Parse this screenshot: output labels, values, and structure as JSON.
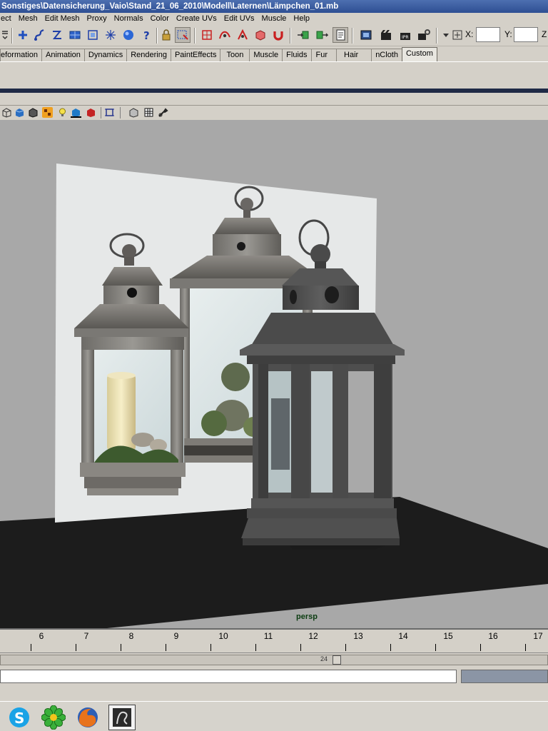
{
  "window": {
    "title": "Sonstiges\\Datensicherung_Vaio\\Stand_21_06_2010\\Modell\\Laternen\\Lämpchen_01.mb"
  },
  "menu": {
    "items": [
      "ect",
      "Mesh",
      "Edit Mesh",
      "Proxy",
      "Normals",
      "Color",
      "Create UVs",
      "Edit UVs",
      "Muscle",
      "Help"
    ]
  },
  "status_line": {
    "x_label": "X:",
    "y_label": "Y:",
    "z_label": "Z",
    "x_value": "",
    "y_value": ""
  },
  "shelf": {
    "tabs": [
      "eformation",
      "Animation",
      "Dynamics",
      "Rendering",
      "PaintEffects",
      "Toon",
      "Muscle",
      "Fluids",
      "Fur",
      "Hair",
      "nCloth",
      "Custom"
    ],
    "active_tab": "Custom"
  },
  "viewport": {
    "camera_label": "persp"
  },
  "timeline": {
    "ticks": [
      "6",
      "7",
      "8",
      "9",
      "10",
      "11",
      "12",
      "13",
      "14",
      "15",
      "16",
      "17"
    ],
    "current_frame": "24"
  },
  "taskbar": {
    "apps": [
      "skype-icon",
      "icq-flower-icon",
      "firefox-icon",
      "maya-icon"
    ]
  },
  "colors": {
    "title_bar": "#2e4f93",
    "viewport_bg": "#a8a8a8",
    "ground_plane": "#1c1c1c",
    "lantern_model": "#4e4e4e",
    "camera_label": "#0c3d12"
  }
}
